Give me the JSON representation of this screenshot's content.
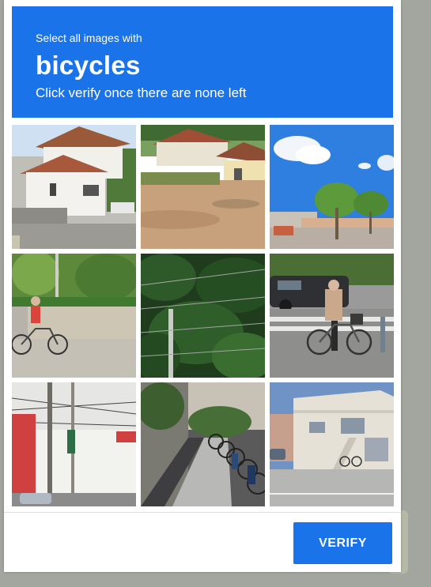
{
  "challenge": {
    "instruction": "Select all images with",
    "target": "bicycles",
    "hint": "Click verify once there are none left"
  },
  "tiles": [
    {
      "name": "tile-houses-street"
    },
    {
      "name": "tile-houses-dirt-lot"
    },
    {
      "name": "tile-blue-sky-trees"
    },
    {
      "name": "tile-cyclist-wall"
    },
    {
      "name": "tile-hedge-fence"
    },
    {
      "name": "tile-cyclist-crosswalk"
    },
    {
      "name": "tile-utility-poles"
    },
    {
      "name": "tile-parked-bicycles"
    },
    {
      "name": "tile-apartment-building"
    }
  ],
  "footer": {
    "verify_label": "VERIFY"
  },
  "colors": {
    "accent": "#1a73e8",
    "backdrop": "#a3a59f"
  }
}
